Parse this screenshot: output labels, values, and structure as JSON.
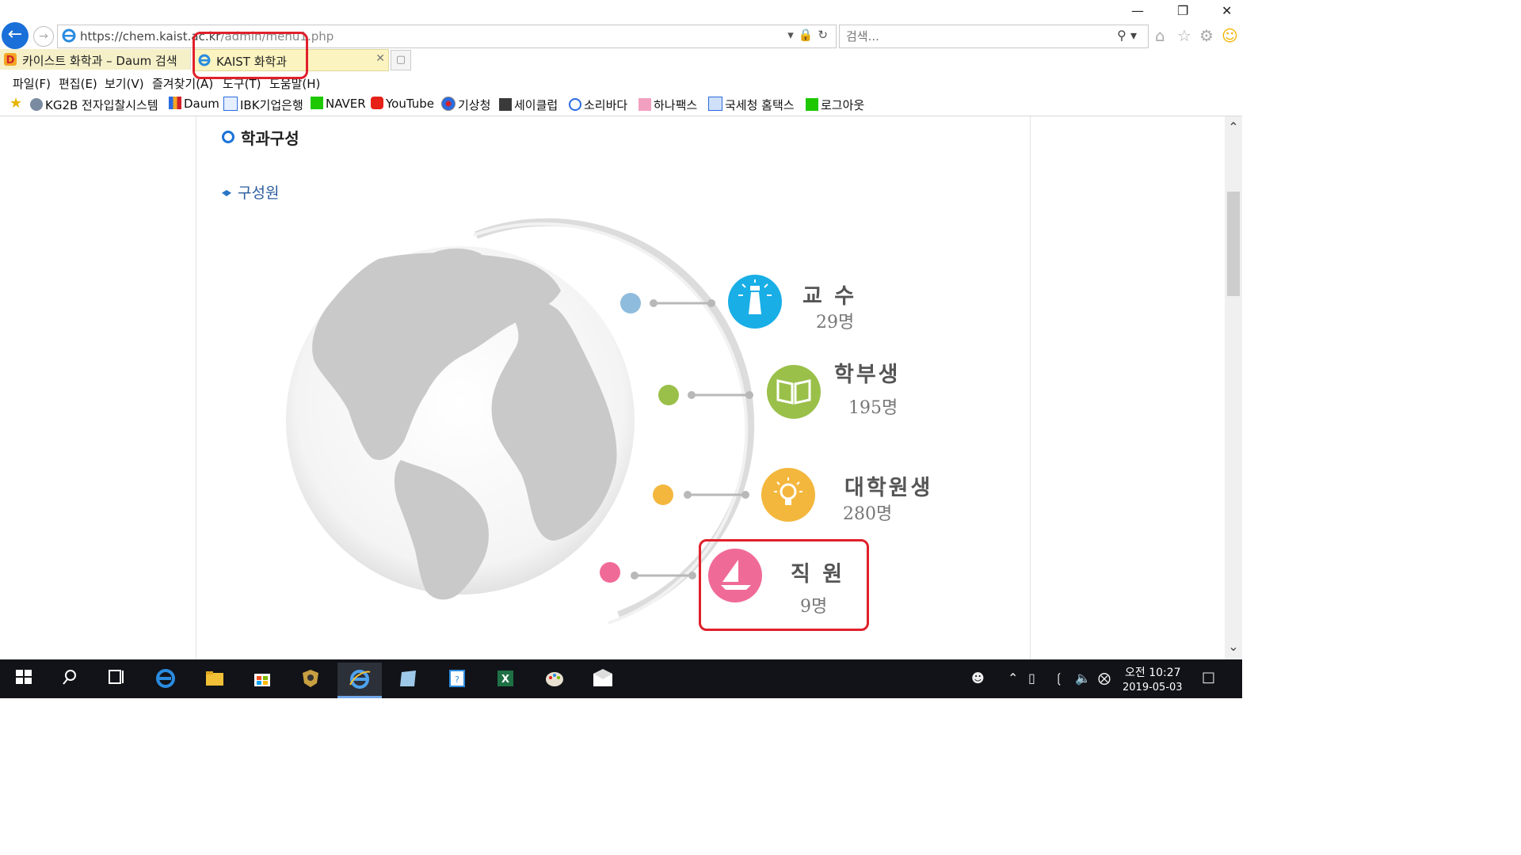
{
  "browser": {
    "url_host": "https://chem.kaist.ac.kr",
    "url_path": "/admin/menu1.php",
    "search_placeholder": "검색...",
    "tabs": [
      {
        "label": "카이스트 화학과 – Daum 검색",
        "active": false
      },
      {
        "label": "KAIST 화학과",
        "active": true
      }
    ],
    "menu": [
      "파일(F)",
      "편집(E)",
      "보기(V)",
      "즐겨찾기(A)",
      "도구(T)",
      "도움말(H)"
    ],
    "favorites": [
      "KG2B 전자입찰시스템",
      "Daum",
      "IBK기업은행",
      "NAVER",
      "YouTube",
      "기상청",
      "세이클럽",
      "소리바다",
      "하나팩스",
      "국세청 홈택스",
      "로그아웃"
    ]
  },
  "page": {
    "section_title": "학과구성",
    "sub_title": "구성원",
    "members": [
      {
        "label": "교 수",
        "count": "29명",
        "color": "#19aee6",
        "icon": "lighthouse-icon"
      },
      {
        "label": "학부생",
        "count": "195명",
        "color": "#9ac04a",
        "icon": "book-icon"
      },
      {
        "label": "대학원생",
        "count": "280명",
        "color": "#f4b73d",
        "icon": "lightbulb-icon"
      },
      {
        "label": "직 원",
        "count": "9명",
        "color": "#f06a98",
        "icon": "sailboat-icon"
      }
    ]
  },
  "taskbar": {
    "time": "오전 10:27",
    "date": "2019-05-03"
  },
  "colors": {
    "annotation": "#e0202a",
    "accent": "#1a6fd8"
  }
}
